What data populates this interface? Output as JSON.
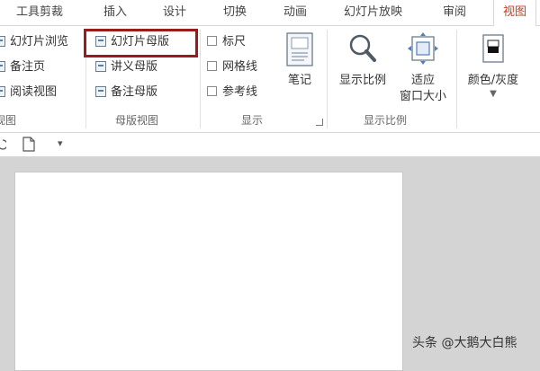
{
  "tabs": [
    "工具剪裁",
    "插入",
    "设计",
    "切换",
    "动画",
    "幻灯片放映",
    "审阅",
    "视图"
  ],
  "presentation_views": {
    "items": [
      "幻灯片浏览",
      "备注页",
      "阅读视图"
    ],
    "group_label": "视图"
  },
  "master_views": {
    "items": [
      "幻灯片母版",
      "讲义母版",
      "备注母版"
    ],
    "group_label": "母版视图"
  },
  "show": {
    "checkboxes": [
      "标尺",
      "网格线",
      "参考线"
    ],
    "notes_label": "笔记",
    "group_label": "显示"
  },
  "zoom": {
    "zoom_label": "显示比例",
    "fit_label_1": "适应",
    "fit_label_2": "窗口大小",
    "group_label": "显示比例"
  },
  "color": {
    "label": "颜色/灰度"
  },
  "quick_access": {
    "dropdown": "▾"
  },
  "watermark": "头条 @大鹅大白熊",
  "colors": {
    "active_tab": "#c43e1c",
    "highlight_box": "#9b1b1b"
  }
}
